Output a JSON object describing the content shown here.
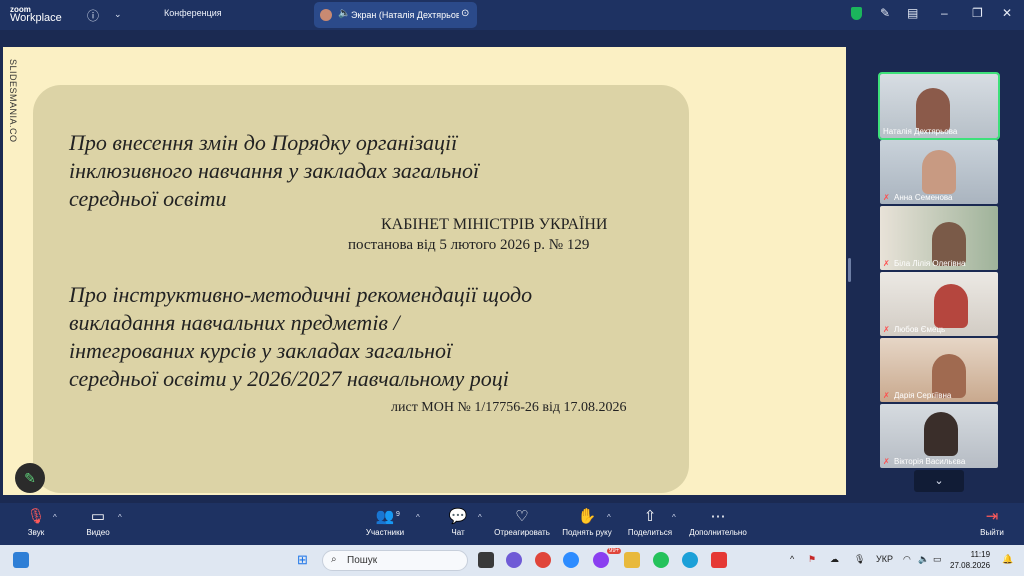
{
  "titlebar": {
    "logo_line1": "zoom",
    "logo_line2": "Workplace",
    "meeting_label": "Конференция",
    "share_tab_label": "Экран (Наталія Дехтярьова)"
  },
  "slide": {
    "brand": "SLIDESMANIA.CO",
    "heading1_line1": "Про внесення змін до Порядку організації",
    "heading1_line2": "інклюзивного навчання у закладах загальної",
    "heading1_line3": "середньої освіти",
    "source1_line1": "КАБІНЕТ МІНІСТРІВ УКРАЇНИ",
    "source1_line2": "постанова від 5 лютого 2026 р. № 129",
    "heading2_line1": "Про інструктивно-методичні рекомендації щодо",
    "heading2_line2": "викладання навчальних предметів /",
    "heading2_line3": "інтегрованих курсів у закладах загальної",
    "heading2_line4": "середньої освіти у 2026/2027 навчальному році",
    "source2": "лист МОН № 1/17756-26 від 17.08.2026"
  },
  "participants": [
    {
      "name": "Наталія Дехтярьова",
      "muted": false
    },
    {
      "name": "Анна Семенова",
      "muted": true
    },
    {
      "name": "Біла Лілія Олегівна",
      "muted": true
    },
    {
      "name": "Любов Ємець",
      "muted": true
    },
    {
      "name": "Дарія Сергіївна",
      "muted": true
    },
    {
      "name": "Вікторія Васильєва",
      "muted": true
    }
  ],
  "toolbar": {
    "audio": "Звук",
    "video": "Видео",
    "participants": "Участники",
    "participants_count": "9",
    "chat": "Чат",
    "react": "Отреагировать",
    "raise_hand": "Поднять руку",
    "share": "Поделиться",
    "more": "Дополнительно",
    "leave": "Выйти"
  },
  "taskbar": {
    "search_placeholder": "Пошук",
    "language": "УКР",
    "time": "11:19",
    "date": "27.08.2026",
    "notification_count": "99+"
  },
  "colors": {
    "slide_bg": "#fbf0c4",
    "card_bg": "#dcd3a6",
    "zoom_bar": "#1e3262",
    "active_speaker": "#3ee07a"
  }
}
